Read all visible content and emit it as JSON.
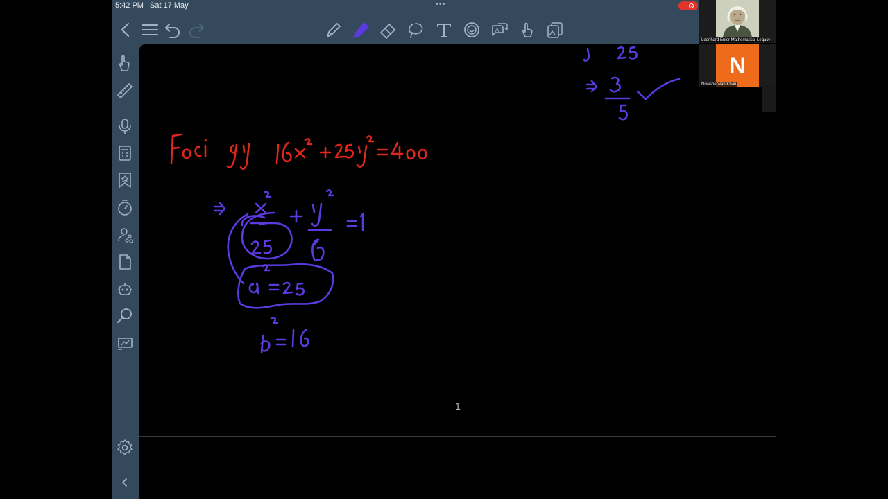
{
  "status_bar": {
    "time": "5:42 PM",
    "date": "Sat 17 May",
    "dots": "•••"
  },
  "toolbar": {
    "left": [
      {
        "name": "back-icon"
      },
      {
        "name": "menu-icon"
      },
      {
        "name": "undo-icon"
      },
      {
        "name": "redo-icon"
      }
    ],
    "tools": [
      {
        "name": "pen-tool-icon"
      },
      {
        "name": "highlighter-tool-icon",
        "selected": true
      },
      {
        "name": "eraser-tool-icon"
      },
      {
        "name": "lasso-tool-icon"
      },
      {
        "name": "text-tool-icon"
      },
      {
        "name": "sticker-tool-icon"
      },
      {
        "name": "translate-tool-icon"
      },
      {
        "name": "hand-tool-icon"
      },
      {
        "name": "image-tool-icon"
      }
    ]
  },
  "sidebar": {
    "items": [
      "pointer-hand-icon",
      "ruler-icon",
      "microphone-icon",
      "calculator-icon",
      "bookmark-icon",
      "timer-icon",
      "share-icon",
      "page-icon",
      "robot-icon",
      "search-icon",
      "presentation-icon"
    ],
    "bottom": [
      "settings-icon",
      "collapse-icon"
    ]
  },
  "canvas": {
    "page_number": "1",
    "handwriting_red": "Foci of 16x² + 25y² = 400",
    "handwriting_blue": [
      "=> x²/25 + y²/16 = 1",
      "a² = 25",
      "b² = 16",
      "√25",
      "=> 3/5"
    ]
  },
  "video_panel": {
    "participants": [
      {
        "name": "Leonhard Euler Mathematical Legacy",
        "kind": "portrait"
      },
      {
        "name": "Nowsherwan Khan",
        "initial": "N"
      }
    ]
  },
  "colors": {
    "toolbar_bg": "#34495c",
    "icon": "#9fb3c4",
    "highlighter": "#5b3ae0",
    "ink_red": "#e0261c",
    "ink_blue": "#5b3ae0",
    "avatar": "#ef6b1c",
    "record": "#e0352b"
  }
}
